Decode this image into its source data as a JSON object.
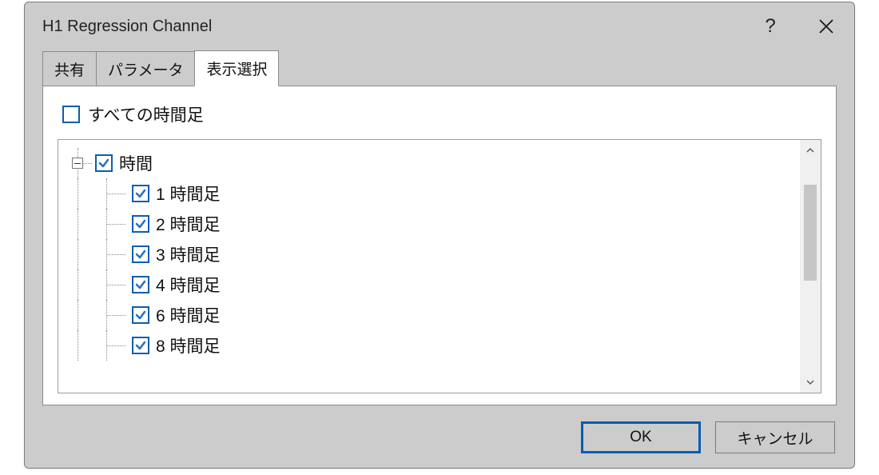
{
  "dialog": {
    "title": "H1 Regression Channel"
  },
  "tabs": [
    {
      "label": "共有",
      "active": false
    },
    {
      "label": "パラメータ",
      "active": false
    },
    {
      "label": "表示選択",
      "active": true
    }
  ],
  "all_timeframes": {
    "label": "すべての時間足",
    "checked": false
  },
  "tree": {
    "group": {
      "label": "時間",
      "checked": true,
      "expanded": true
    },
    "items": [
      {
        "label": "1 時間足",
        "checked": true
      },
      {
        "label": "2 時間足",
        "checked": true
      },
      {
        "label": "3 時間足",
        "checked": true
      },
      {
        "label": "4 時間足",
        "checked": true
      },
      {
        "label": "6 時間足",
        "checked": true
      },
      {
        "label": "8 時間足",
        "checked": true
      }
    ]
  },
  "buttons": {
    "ok": "OK",
    "cancel": "キャンセル"
  }
}
